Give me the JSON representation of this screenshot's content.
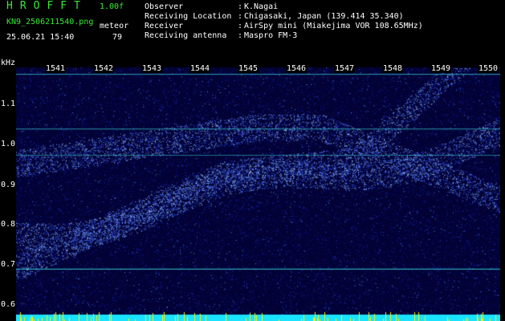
{
  "header": {
    "logo": "HROFFT",
    "version": "1.00f",
    "filename": "KN9_2506211540.png",
    "meteor_label": "meteor",
    "datetime": "25.06.21 15:40",
    "meteor_count": "79"
  },
  "info": [
    {
      "key": "Observer",
      "value": "K.Nagai"
    },
    {
      "key": "Receiving Location",
      "value": "Chigasaki, Japan (139.414 35.340)"
    },
    {
      "key": "Receiver",
      "value": "AirSpy mini (Miakejima VOR 108.65MHz)"
    },
    {
      "key": "Receiving antenna",
      "value": "Maspro FM-3"
    }
  ],
  "separator": ":",
  "axis": {
    "y_unit": "kHz",
    "y_ticks": [
      "1.1",
      "1.0",
      "0.9",
      "0.8",
      "0.7",
      "0.6"
    ],
    "x_ticks": [
      "1541",
      "1542",
      "1543",
      "1544",
      "1545",
      "1546",
      "1547",
      "1548",
      "1549",
      "1550"
    ]
  },
  "colors": {
    "background": "#000000",
    "plot_bg": "#020236",
    "accent_green": "#38e838",
    "signal_cyan": "#40e0e0",
    "bottom_bar": "#19e3ff",
    "spikes": "#f8f000"
  }
}
